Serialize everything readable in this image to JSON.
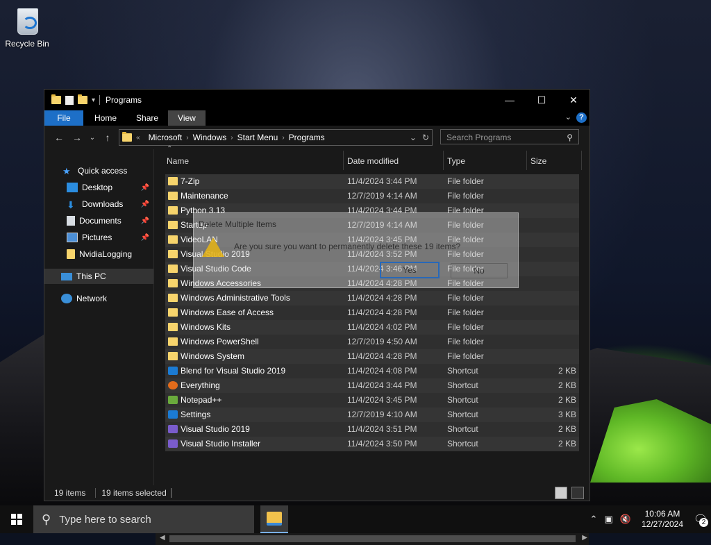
{
  "desktop": {
    "recycle_bin_label": "Recycle Bin"
  },
  "window": {
    "title": "Programs",
    "ribbon_tabs": [
      "File",
      "Home",
      "Share",
      "View"
    ],
    "help_label": "?",
    "breadcrumb": [
      "Microsoft",
      "Windows",
      "Start Menu",
      "Programs"
    ],
    "breadcrumb_prefix": "«",
    "search_placeholder": "Search Programs",
    "columns": {
      "name": "Name",
      "date": "Date modified",
      "type": "Type",
      "size": "Size"
    },
    "nav": {
      "quick_access": "Quick access",
      "items": [
        "Desktop",
        "Downloads",
        "Documents",
        "Pictures",
        "NvidiaLogging"
      ],
      "this_pc": "This PC",
      "network": "Network"
    },
    "rows": [
      {
        "name": "7-Zip",
        "date": "11/4/2024 3:44 PM",
        "type": "File folder",
        "size": "",
        "icon": "folder"
      },
      {
        "name": "Maintenance",
        "date": "12/7/2019 4:14 AM",
        "type": "File folder",
        "size": "",
        "icon": "folder"
      },
      {
        "name": "Python 3.13",
        "date": "11/4/2024 3:44 PM",
        "type": "File folder",
        "size": "",
        "icon": "folder"
      },
      {
        "name": "Startup",
        "date": "12/7/2019 4:14 AM",
        "type": "File folder",
        "size": "",
        "icon": "folder"
      },
      {
        "name": "VideoLAN",
        "date": "11/4/2024 3:45 PM",
        "type": "File folder",
        "size": "",
        "icon": "folder"
      },
      {
        "name": "Visual Studio 2019",
        "date": "11/4/2024 3:52 PM",
        "type": "File folder",
        "size": "",
        "icon": "folder"
      },
      {
        "name": "Visual Studio Code",
        "date": "11/4/2024 3:46 PM",
        "type": "File folder",
        "size": "",
        "icon": "folder"
      },
      {
        "name": "Windows Accessories",
        "date": "11/4/2024 4:28 PM",
        "type": "File folder",
        "size": "",
        "icon": "folder"
      },
      {
        "name": "Windows Administrative Tools",
        "date": "11/4/2024 4:28 PM",
        "type": "File folder",
        "size": "",
        "icon": "folder"
      },
      {
        "name": "Windows Ease of Access",
        "date": "11/4/2024 4:28 PM",
        "type": "File folder",
        "size": "",
        "icon": "folder"
      },
      {
        "name": "Windows Kits",
        "date": "11/4/2024 4:02 PM",
        "type": "File folder",
        "size": "",
        "icon": "folder"
      },
      {
        "name": "Windows PowerShell",
        "date": "12/7/2019 4:50 AM",
        "type": "File folder",
        "size": "",
        "icon": "folder"
      },
      {
        "name": "Windows System",
        "date": "11/4/2024 4:28 PM",
        "type": "File folder",
        "size": "",
        "icon": "folder"
      },
      {
        "name": "Blend for Visual Studio 2019",
        "date": "11/4/2024 4:08 PM",
        "type": "Shortcut",
        "size": "2 KB",
        "icon": "blend"
      },
      {
        "name": "Everything",
        "date": "11/4/2024 3:44 PM",
        "type": "Shortcut",
        "size": "2 KB",
        "icon": "everything"
      },
      {
        "name": "Notepad++",
        "date": "11/4/2024 3:45 PM",
        "type": "Shortcut",
        "size": "2 KB",
        "icon": "notepadpp"
      },
      {
        "name": "Settings",
        "date": "12/7/2019 4:10 AM",
        "type": "Shortcut",
        "size": "3 KB",
        "icon": "settings"
      },
      {
        "name": "Visual Studio 2019",
        "date": "11/4/2024 3:51 PM",
        "type": "Shortcut",
        "size": "2 KB",
        "icon": "visualstudio"
      },
      {
        "name": "Visual Studio Installer",
        "date": "11/4/2024 3:50 PM",
        "type": "Shortcut",
        "size": "2 KB",
        "icon": "vsinstaller"
      }
    ],
    "status": {
      "count": "19 items",
      "selected": "19 items selected"
    }
  },
  "dialog": {
    "title": "Delete Multiple Items",
    "message": "Are you sure you want to permanently delete these 19 items?",
    "yes_label": "Yes",
    "no_label": "No"
  },
  "taskbar": {
    "search_placeholder": "Type here to search",
    "time": "10:06 AM",
    "date": "12/27/2024",
    "notification_count": "2"
  },
  "colors": {
    "accent": "#1d6fc7",
    "folder": "#f7d46c",
    "window_bg": "#191919"
  }
}
